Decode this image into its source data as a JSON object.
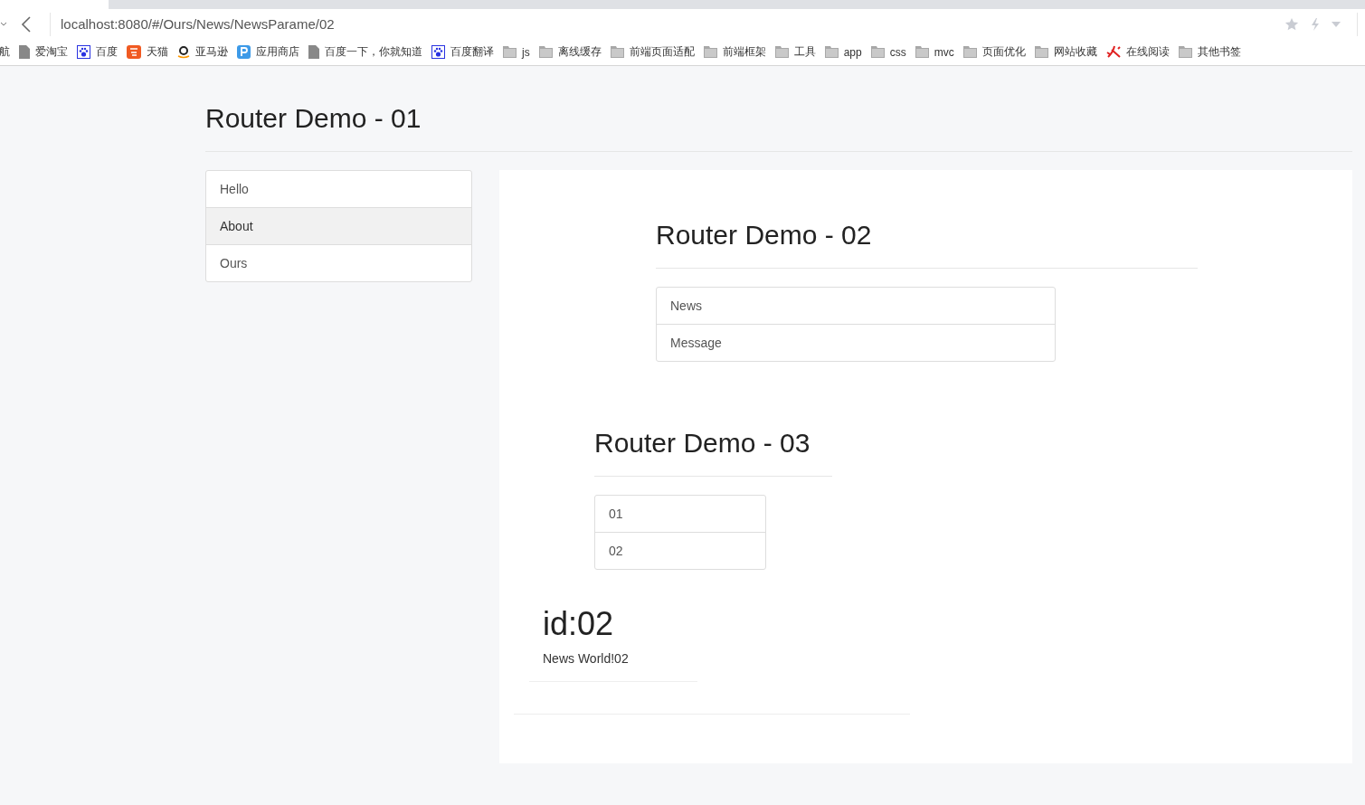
{
  "browser": {
    "address": "localhost:8080/#/Ours/News/NewsParame/02",
    "bookmarks": [
      {
        "label": "航",
        "kind": "none"
      },
      {
        "label": "爱淘宝",
        "kind": "page"
      },
      {
        "label": "百度",
        "kind": "paw"
      },
      {
        "label": "天猫",
        "kind": "tao"
      },
      {
        "label": "亚马逊",
        "kind": "amazon"
      },
      {
        "label": "应用商店",
        "kind": "store"
      },
      {
        "label": "百度一下，你就知道",
        "kind": "page"
      },
      {
        "label": "百度翻译",
        "kind": "paw"
      },
      {
        "label": "js",
        "kind": "folder"
      },
      {
        "label": "离线缓存",
        "kind": "folder"
      },
      {
        "label": "前端页面适配",
        "kind": "folder"
      },
      {
        "label": "前端框架",
        "kind": "folder"
      },
      {
        "label": "工具",
        "kind": "folder"
      },
      {
        "label": "app",
        "kind": "folder"
      },
      {
        "label": "css",
        "kind": "folder"
      },
      {
        "label": "mvc",
        "kind": "folder"
      },
      {
        "label": "页面优化",
        "kind": "folder"
      },
      {
        "label": "网站收藏",
        "kind": "folder"
      },
      {
        "label": "在线阅读",
        "kind": "brush"
      },
      {
        "label": "其他书签",
        "kind": "folder"
      }
    ]
  },
  "level1": {
    "title": "Router Demo - 01",
    "nav": [
      {
        "label": "Hello",
        "selected": false
      },
      {
        "label": "About",
        "selected": true
      },
      {
        "label": "Ours",
        "selected": false
      }
    ]
  },
  "level2": {
    "title": "Router Demo - 02",
    "nav": [
      {
        "label": "News",
        "selected": false
      },
      {
        "label": "Message",
        "selected": false
      }
    ]
  },
  "level3": {
    "title": "Router Demo - 03",
    "nav": [
      {
        "label": "01",
        "selected": false
      },
      {
        "label": "02",
        "selected": false
      }
    ]
  },
  "detail": {
    "heading": "id:02",
    "text": "News World!02"
  }
}
